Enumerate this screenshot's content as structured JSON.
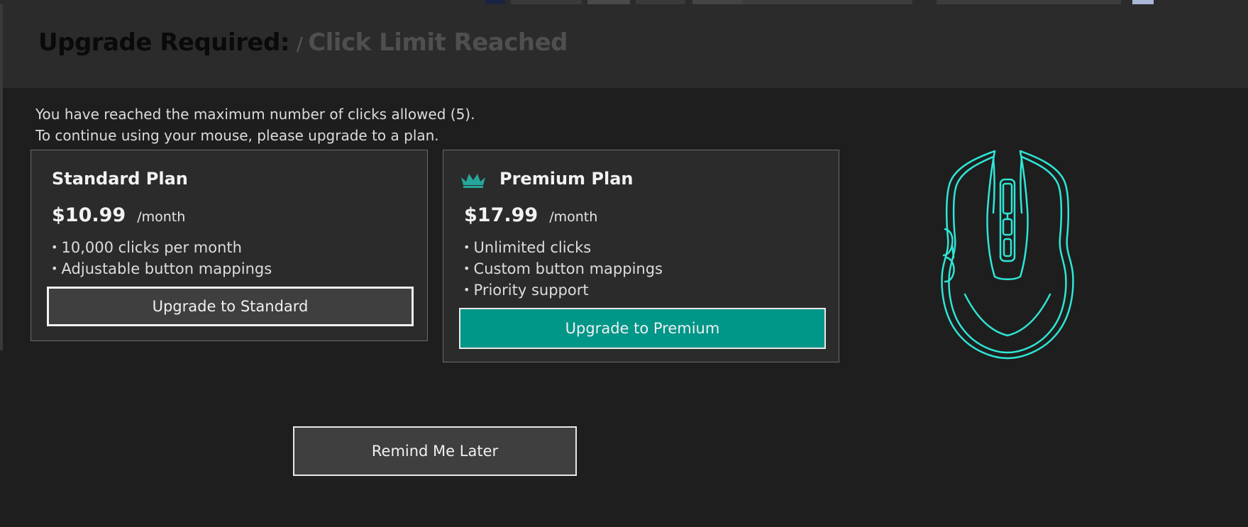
{
  "header": {
    "title_bold": "Upgrade Required:",
    "separator": "/",
    "title_sub": "Click Limit Reached"
  },
  "message": {
    "line1": "You have reached the maximum number of clicks allowed (5).",
    "line2": "To continue using your mouse, please upgrade to a plan."
  },
  "plans": {
    "standard": {
      "name": "Standard Plan",
      "price": "$10.99",
      "period": "/month",
      "features": [
        "10,000 clicks per month",
        "Adjustable button mappings"
      ],
      "button_label": "Upgrade to Standard"
    },
    "premium": {
      "icon": "crown-icon",
      "name": "Premium Plan",
      "price": "$17.99",
      "period": "/month",
      "features": [
        "Unlimited clicks",
        "Custom button mappings",
        "Priority support"
      ],
      "button_label": "Upgrade to Premium"
    }
  },
  "remind_button_label": "Remind Me Later",
  "illustration": {
    "icon": "mouse-icon"
  },
  "colors": {
    "background": "#1e1e1e",
    "panel": "#2b2b2b",
    "accent": "#009688",
    "illustration_stroke": "#2ee6d6",
    "crown": "#26a69a"
  }
}
